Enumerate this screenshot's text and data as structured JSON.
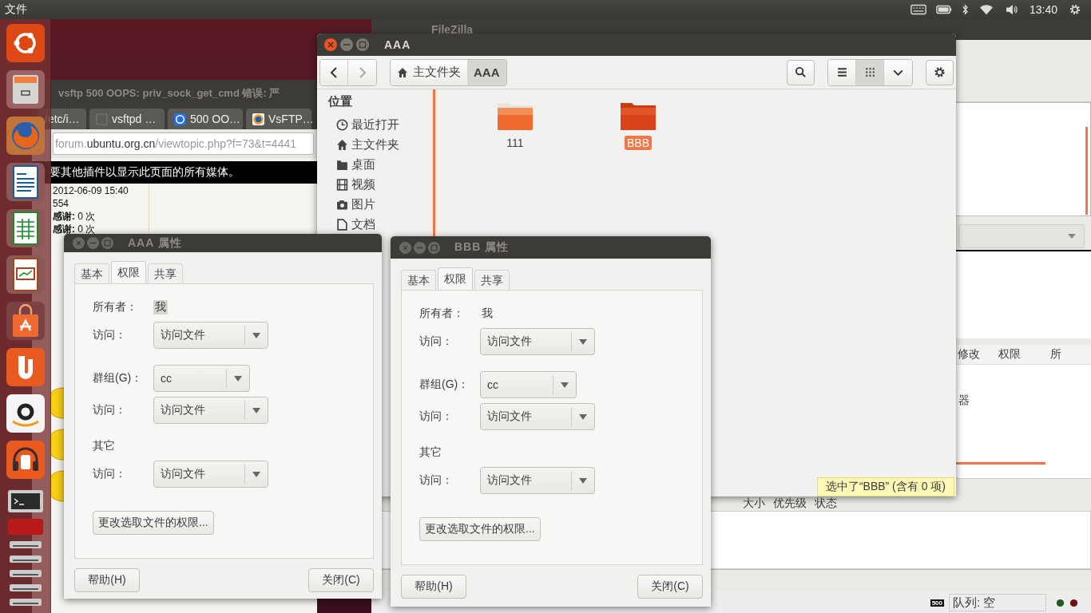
{
  "top_panel": {
    "app_menu": "文件",
    "clock": "13:40"
  },
  "browser": {
    "title": "vsftp 500 OOPS: priv_sock_get_cmd 错误: 严",
    "tabs": [
      {
        "label": "/etc/i…",
        "kind": "plain",
        "selected": false
      },
      {
        "label": "vsftpd …",
        "kind": "blank",
        "selected": false
      },
      {
        "label": "500 OO…",
        "kind": "blue",
        "selected": false
      },
      {
        "label": "VsFTP…",
        "kind": "orange",
        "selected": false
      }
    ],
    "url": "forum.**ubuntu.org.cn**/viewtopic.php?f=73&t=4441",
    "plugin_notice": "要其他插件以显示此页面的所有媒体。",
    "post_lines": [
      "2012-06-09 15:40",
      "554",
      "**感谢:** 0 次",
      "**感谢:** 0 次"
    ]
  },
  "filezilla": {
    "title": "FileZilla",
    "remote_columns": [
      "修改",
      "权限",
      "所"
    ],
    "remote_item": "器",
    "queue_columns": [
      "大小",
      "优先级",
      "状态"
    ],
    "speed_limit_badge": "500",
    "queue_status": "队列: 空"
  },
  "file_manager": {
    "title": "AAA",
    "path": [
      {
        "label": "主文件夹",
        "kind": "home",
        "selected": false
      },
      {
        "label": "AAA",
        "kind": "plain",
        "selected": true
      }
    ],
    "view_buttons": [
      {
        "kind": "list",
        "selected": false
      },
      {
        "kind": "grid",
        "selected": true
      },
      {
        "kind": "menu",
        "selected": false
      }
    ],
    "sidebar_heading": "位置",
    "sidebar_items": [
      {
        "label": "最近打开",
        "kind": "recent"
      },
      {
        "label": "主文件夹",
        "kind": "home"
      },
      {
        "label": "桌面",
        "kind": "desktop"
      },
      {
        "label": "视频",
        "kind": "video"
      },
      {
        "label": "图片",
        "kind": "pictures"
      },
      {
        "label": "文档",
        "kind": "documents"
      }
    ],
    "files": [
      {
        "name": "111",
        "selected": false
      },
      {
        "name": "BBB",
        "selected": true
      }
    ],
    "status": "选中了“BBB” (含有 0 项)"
  },
  "dialogs": [
    {
      "title": "AAA 属性",
      "tabs": [
        {
          "label": "基本",
          "selected": false
        },
        {
          "label": "权限",
          "selected": true
        },
        {
          "label": "共享",
          "selected": false
        }
      ],
      "rows": [
        {
          "kind": "owner",
          "label": "所有者：",
          "value": "我",
          "highlighted": true
        },
        {
          "kind": "access",
          "label": "访问：",
          "value": "访问文件"
        },
        {
          "kind": "group",
          "label": "群组(G)：",
          "value": "cc"
        },
        {
          "kind": "access",
          "label": "访问：",
          "value": "访问文件"
        },
        {
          "kind": "heading",
          "label": "其它"
        },
        {
          "kind": "access",
          "label": "访问：",
          "value": "访问文件"
        }
      ],
      "change_button": "更改选取文件的权限...",
      "help_button": "帮助(H)",
      "close_button": "关闭(C)"
    },
    {
      "title": "BBB 属性",
      "tabs": [
        {
          "label": "基本",
          "selected": false
        },
        {
          "label": "权限",
          "selected": true
        },
        {
          "label": "共享",
          "selected": false
        }
      ],
      "rows": [
        {
          "kind": "owner",
          "label": "所有者：",
          "value": "我",
          "highlighted": false
        },
        {
          "kind": "access",
          "label": "访问：",
          "value": "访问文件"
        },
        {
          "kind": "group",
          "label": "群组(G)：",
          "value": "cc"
        },
        {
          "kind": "access",
          "label": "访问：",
          "value": "访问文件"
        },
        {
          "kind": "heading",
          "label": "其它"
        },
        {
          "kind": "access",
          "label": "访问：",
          "value": "访问文件"
        }
      ],
      "change_button": "更改选取文件的权限...",
      "help_button": "帮助(H)",
      "close_button": "关闭(C)"
    }
  ]
}
